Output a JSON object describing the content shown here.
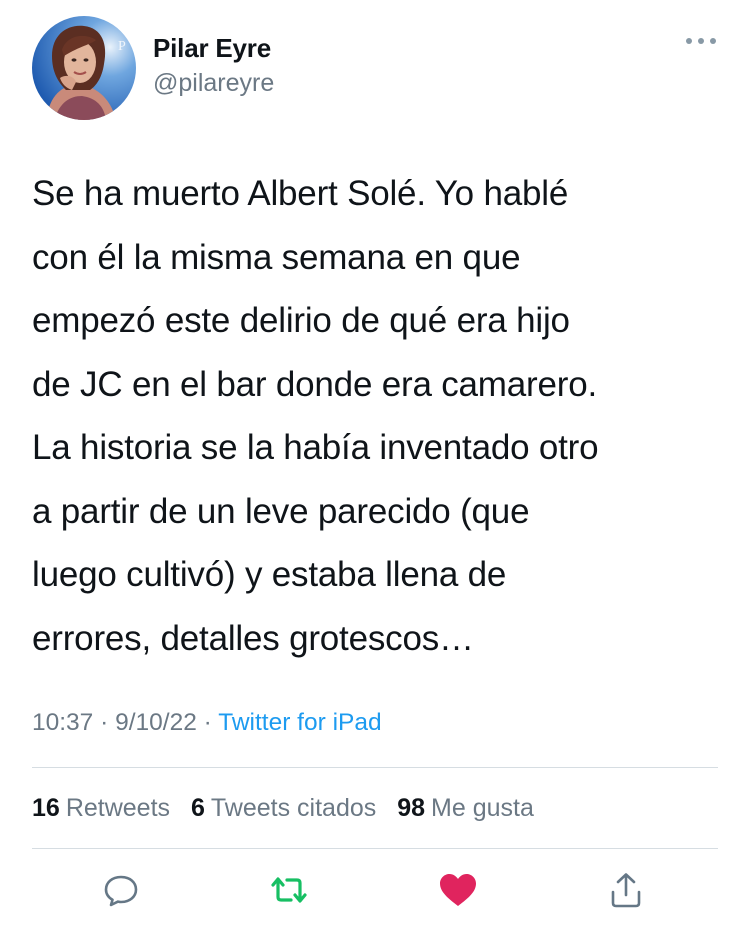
{
  "user": {
    "display_name": "Pilar Eyre",
    "handle": "@pilareyre",
    "avatar_icon": "user-avatar-photo"
  },
  "tweet": {
    "text": "Se ha muerto Albert Solé. Yo hablé\ncon él la misma semana en que\nempezó este delirio de qué era hijo\nde JC en el bar donde  era camarero.\nLa historia se la había inventado otro\na partir de un leve parecido (que\nluego cultivó) y estaba llena de\nerrores, detalles grotescos…",
    "time": "10:37",
    "date": "9/10/22",
    "separator": "·",
    "source": "Twitter for iPad"
  },
  "stats": {
    "retweets_count": "16",
    "retweets_label": "Retweets",
    "quotes_count": "6",
    "quotes_label": "Tweets citados",
    "likes_count": "98",
    "likes_label": "Me gusta"
  },
  "actions": {
    "reply_icon": "comment-icon",
    "retweet_icon": "retweet-icon",
    "like_icon": "heart-icon",
    "share_icon": "share-icon"
  },
  "colors": {
    "text_primary": "#0f1419",
    "text_secondary": "#6b7884",
    "link_blue": "#1d9bf0",
    "retweet_green": "#17bf63",
    "like_red": "#e0245e",
    "divider": "#d6dde2"
  }
}
